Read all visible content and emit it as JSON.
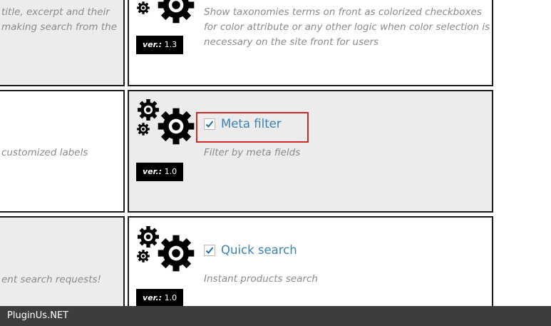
{
  "left_column": {
    "card1_lines": [
      "title, excerpt and their",
      "making search from the"
    ],
    "card2_line": "customized labels",
    "card3_line": "ent search requests!"
  },
  "extensions": [
    {
      "title": "",
      "checked": false,
      "description_lines": [
        "Show taxonomies terms on front as colorized checkboxes",
        "for color attribute or any other logic when color selection is",
        "necessary on the site front for users"
      ],
      "version_label": "ver.:",
      "version": "1.3"
    },
    {
      "title": "Meta filter",
      "checked": true,
      "description_lines": [
        "Filter by meta fields"
      ],
      "version_label": "ver.:",
      "version": "1.0"
    },
    {
      "title": "Quick search",
      "checked": true,
      "description_lines": [
        "Instant products search"
      ],
      "version_label": "ver.:",
      "version": "1.0"
    }
  ],
  "footer": {
    "text": "PluginUs.NET"
  },
  "colors": {
    "link": "#3b82b3",
    "highlight": "#cc2828",
    "card_gray": "#ececec",
    "footer_bg": "#3d3d3d"
  },
  "icons": {
    "gears": "gears-icon",
    "check": "check-icon"
  }
}
